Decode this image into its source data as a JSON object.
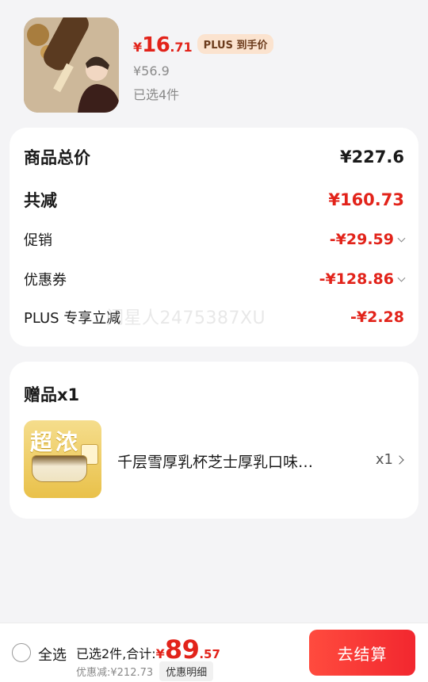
{
  "product": {
    "thumbnail_icon": "ice-cream-bar-photo",
    "price_symbol": "¥",
    "price_int": "16",
    "price_dec": ".71",
    "plus_tag": "PLUS 到手价",
    "original_price": "¥56.9",
    "selected_count": "已选4件"
  },
  "summary": {
    "rows": [
      {
        "label": "商品总价",
        "value": "¥227.6"
      },
      {
        "label": "共减",
        "value": "¥160.73"
      },
      {
        "label": "促销",
        "value": "-¥29.59"
      },
      {
        "label": "优惠券",
        "value": "-¥128.86"
      },
      {
        "label": "PLUS 专享立减",
        "value": "-¥2.28"
      }
    ],
    "watermark": "闲星人2475387XU"
  },
  "gift": {
    "title": "赠品x1",
    "thumb_text": "超浓",
    "name": "千层雪厚乳杯芝士厚乳口味…",
    "qty": "x1"
  },
  "bottom_bar": {
    "select_all": "全选",
    "total_prefix": "已选2件,合计:",
    "total_symbol": "¥",
    "total_int": "89",
    "total_dec": ".57",
    "discount": "优惠减:¥212.73",
    "detail_button": "优惠明细",
    "checkout_button": "去结算"
  },
  "colors": {
    "accent_red": "#e2231a",
    "plus_tag_bg": "#fbe3cf",
    "checkout_gradient_start": "#ff4b3e",
    "checkout_gradient_end": "#f2272f"
  }
}
